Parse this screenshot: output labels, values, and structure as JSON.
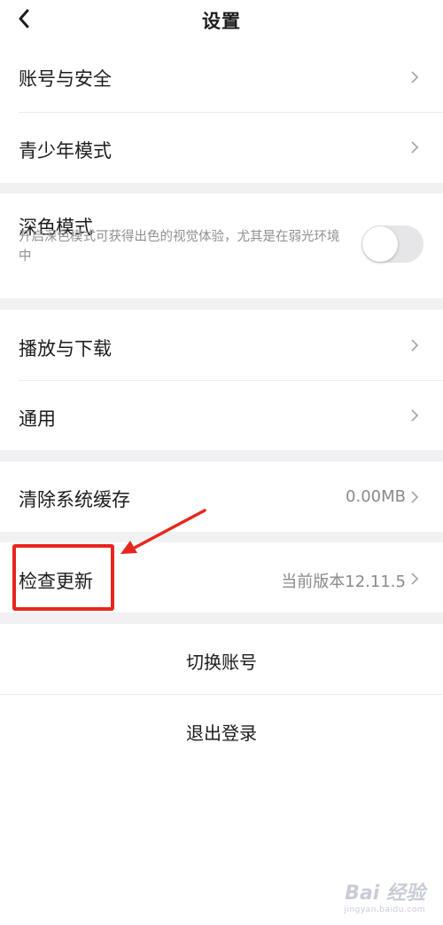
{
  "header": {
    "title": "设置"
  },
  "group1": [
    {
      "label": "账号与安全"
    },
    {
      "label": "青少年模式"
    }
  ],
  "dark_mode": {
    "label": "深色模式",
    "description": "开启深色模式可获得出色的视觉体验，尤其是在弱光环境中",
    "enabled": false
  },
  "group3": [
    {
      "label": "播放与下载"
    },
    {
      "label": "通用"
    }
  ],
  "cache": {
    "label": "清除系统缓存",
    "value": "0.00MB"
  },
  "update": {
    "label": "检查更新",
    "value": "当前版本12.11.5"
  },
  "actions": {
    "switch_account": "切换账号",
    "logout": "退出登录"
  },
  "annotation": {
    "color": "#e8261f"
  },
  "watermark": {
    "text": "Bai 经验",
    "sub": "jingyan.baidu.com"
  }
}
